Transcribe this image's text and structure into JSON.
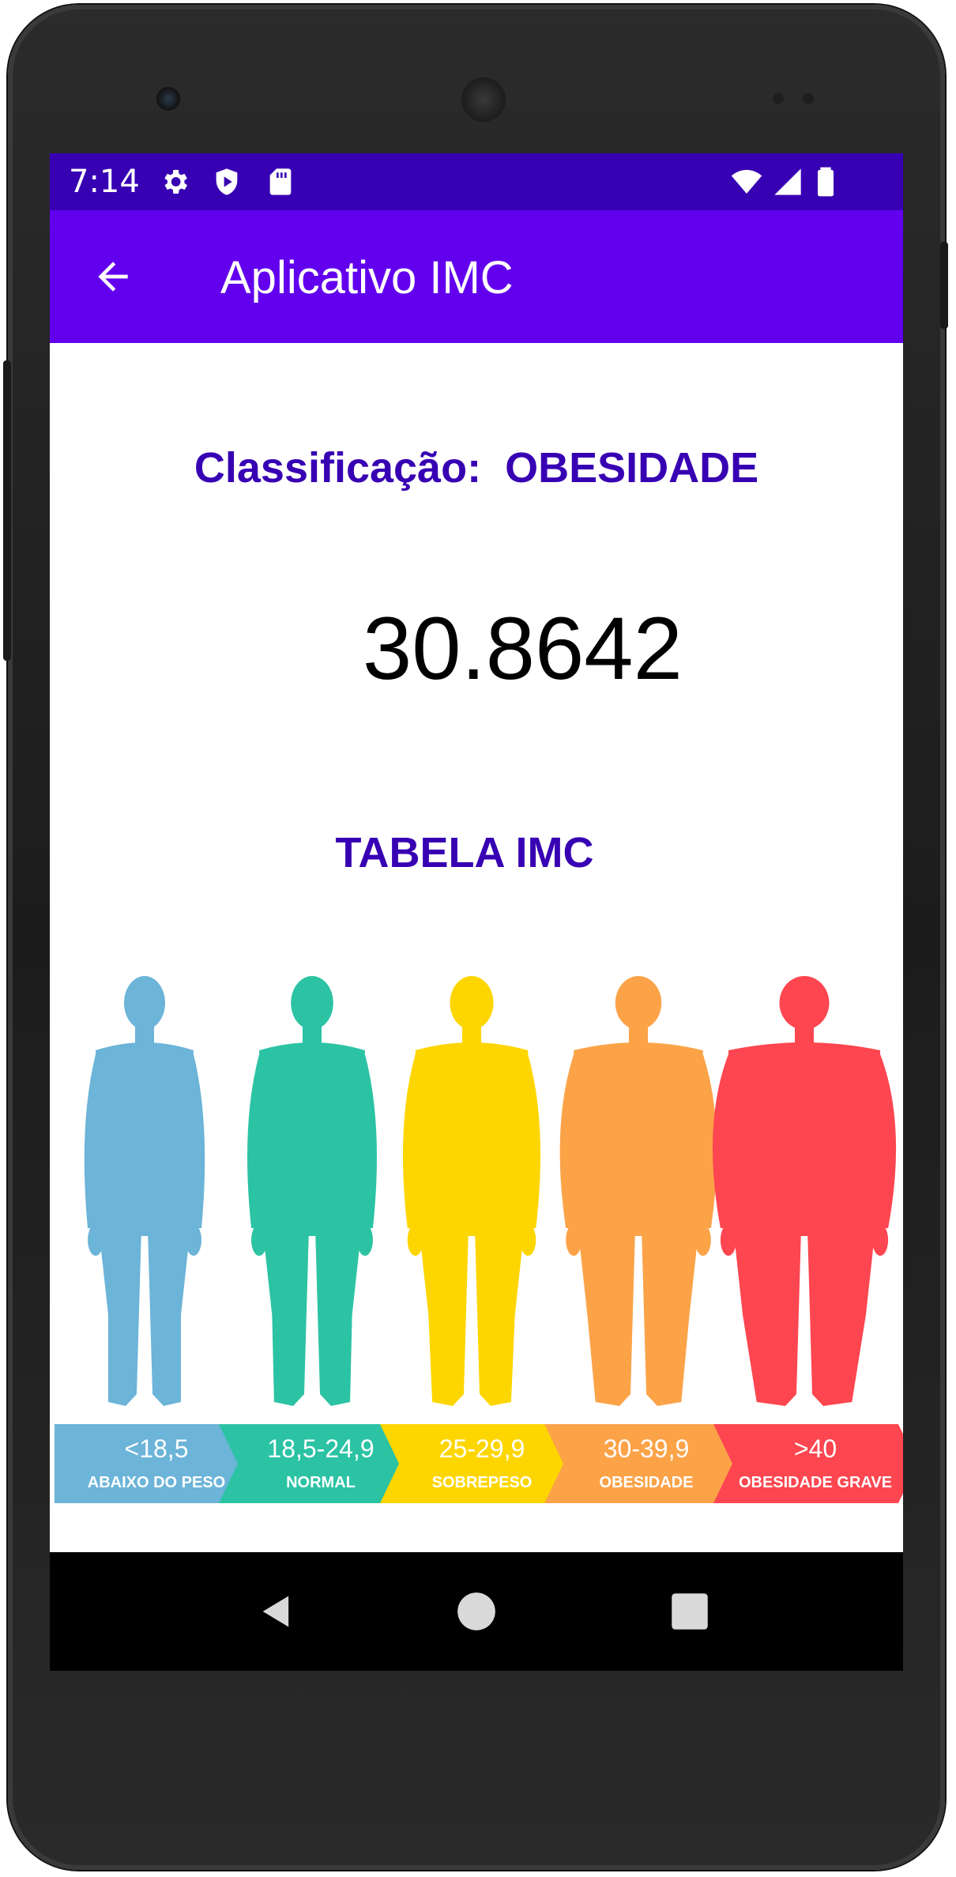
{
  "status_bar": {
    "time": "7:14",
    "icons_left": [
      "gear-icon",
      "shield-icon",
      "sd-card-icon"
    ],
    "icons_right": [
      "wifi-icon",
      "signal-icon",
      "battery-icon"
    ],
    "color": "#3700b3"
  },
  "app_bar": {
    "title": "Aplicativo IMC",
    "back_icon": "arrow-left-icon",
    "color": "#6200ee"
  },
  "result": {
    "classification_text": "Classificação:  OBESIDADE",
    "imc_value": "30.8642",
    "accent_color": "#3700b3"
  },
  "table": {
    "title": "TABELA IMC",
    "bands": [
      {
        "range": "<18,5",
        "label": "ABAIXO DO PESO",
        "color": "#6cb4d8"
      },
      {
        "range": "18,5-24,9",
        "label": "NORMAL",
        "color": "#2bc3a4"
      },
      {
        "range": "25-29,9",
        "label": "SOBREPESO",
        "color": "#fdd600"
      },
      {
        "range": "30-39,9",
        "label": "OBESIDADE",
        "color": "#fca348"
      },
      {
        "range": ">40",
        "label": "OBESIDADE GRAVE",
        "color": "#fd4650"
      }
    ]
  },
  "nav_bar": {
    "buttons": [
      "back-triangle-icon",
      "home-circle-icon",
      "recents-square-icon"
    ]
  }
}
